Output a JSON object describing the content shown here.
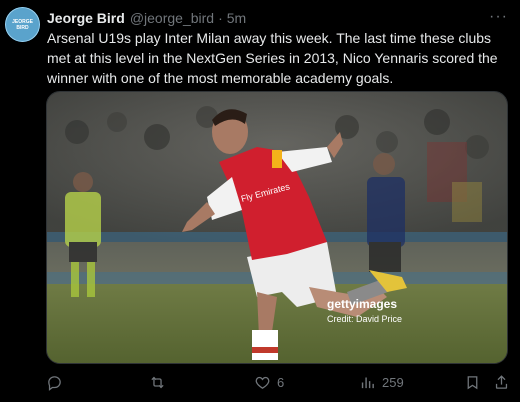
{
  "tweet": {
    "author_name": "Jeorge Bird",
    "author_handle": "@jeorge_bird",
    "separator": "·",
    "time": "5m",
    "avatar_text": "JEORGE BIRD",
    "more_label": "···",
    "text": "Arsenal U19s play Inter Milan away this week. The last time these clubs met at this level in the NextGen Series in 2013, Nico Yennaris scored the winner with one of the most memorable academy goals."
  },
  "media": {
    "watermark": "gettyimages",
    "credit": "Credit: David Price",
    "shirt_text": "Fly Emirates"
  },
  "actions": {
    "reply_count": "",
    "retweet_count": "",
    "like_count": "6",
    "view_count": "259"
  },
  "colors": {
    "background": "#000000",
    "text": "#e7e9ea",
    "muted": "#71767b",
    "shirt_red": "#d01f2e"
  },
  "icons": [
    "reply-icon",
    "retweet-icon",
    "like-icon",
    "views-icon",
    "bookmark-icon",
    "share-icon",
    "more-icon"
  ]
}
